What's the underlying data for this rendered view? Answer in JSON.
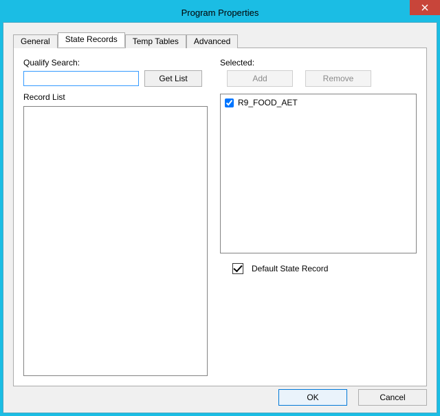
{
  "window": {
    "title": "Program Properties"
  },
  "tabs": [
    {
      "label": "General",
      "active": false
    },
    {
      "label": "State Records",
      "active": true
    },
    {
      "label": "Temp Tables",
      "active": false
    },
    {
      "label": "Advanced",
      "active": false
    }
  ],
  "left": {
    "qualify_label": "Qualify Search:",
    "qualify_value": "",
    "get_list_label": "Get List",
    "record_list_label": "Record List"
  },
  "right": {
    "selected_label": "Selected:",
    "add_label": "Add",
    "remove_label": "Remove",
    "add_enabled": false,
    "remove_enabled": false,
    "items": [
      {
        "label": "R9_FOOD_AET",
        "checked": true
      }
    ],
    "default_state_label": "Default State Record",
    "default_state_checked": true
  },
  "buttons": {
    "ok": "OK",
    "cancel": "Cancel"
  }
}
